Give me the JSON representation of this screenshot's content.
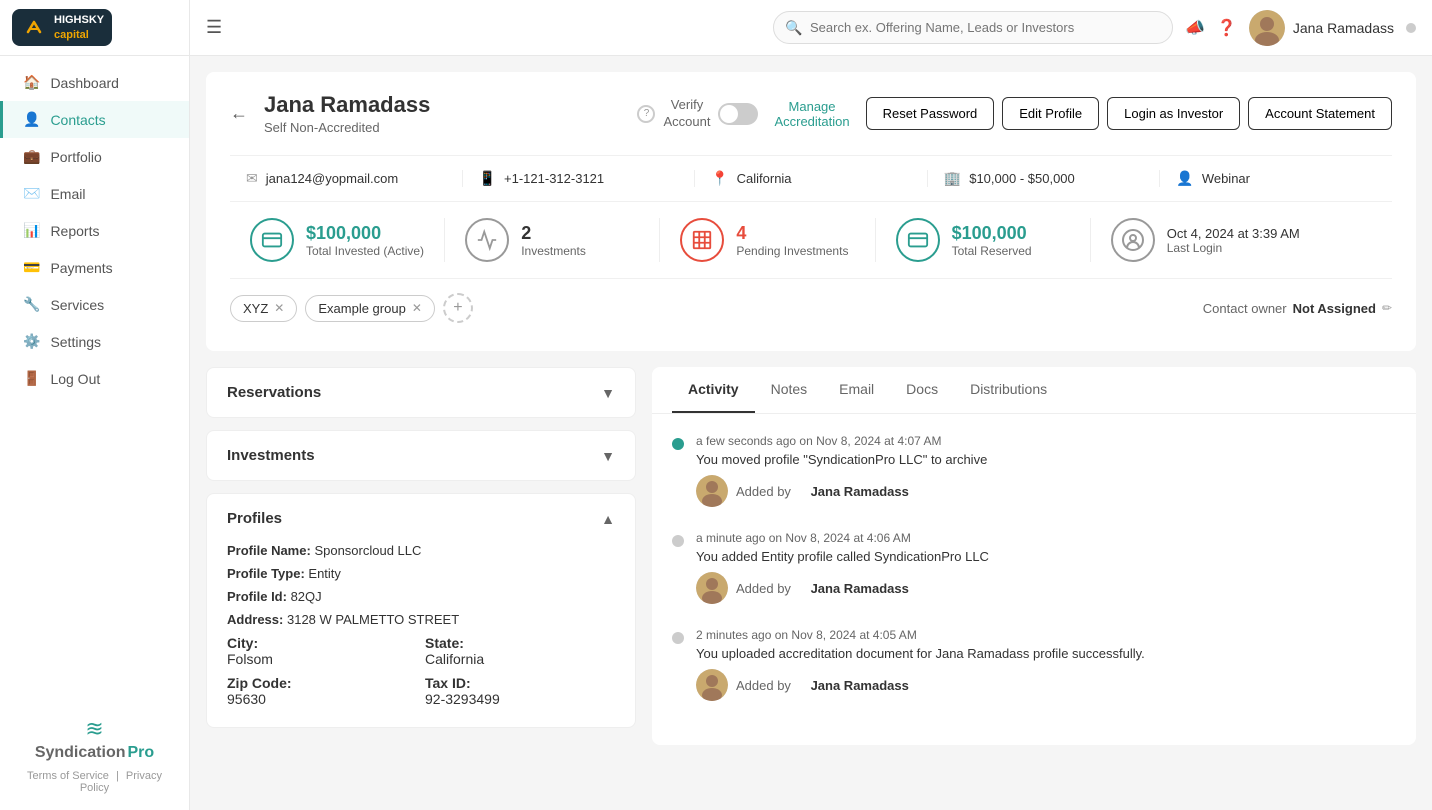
{
  "topnav": {
    "logo_text": "HIGHSKY\ncapital",
    "search_placeholder": "Search ex. Offering Name, Leads or Investors",
    "user_name": "Jana Ramadass"
  },
  "sidebar": {
    "items": [
      {
        "id": "dashboard",
        "label": "Dashboard",
        "icon": "🏠"
      },
      {
        "id": "contacts",
        "label": "Contacts",
        "icon": "👤",
        "active": true
      },
      {
        "id": "portfolio",
        "label": "Portfolio",
        "icon": "💼"
      },
      {
        "id": "email",
        "label": "Email",
        "icon": "✉️"
      },
      {
        "id": "reports",
        "label": "Reports",
        "icon": "📊"
      },
      {
        "id": "payments",
        "label": "Payments",
        "icon": "💳"
      },
      {
        "id": "services",
        "label": "Services",
        "icon": "🔧"
      },
      {
        "id": "settings",
        "label": "Settings",
        "icon": "⚙️"
      },
      {
        "id": "logout",
        "label": "Log Out",
        "icon": "🚪"
      }
    ],
    "brand": {
      "line1": "Syndication",
      "line2": "Pro",
      "links": [
        "Terms of Service",
        "Privacy Policy"
      ]
    }
  },
  "profile": {
    "name": "Jana Ramadass",
    "status": "Self Non-Accredited",
    "verify_label": "Verify\nAccount",
    "manage_accreditation": "Manage\nAccreditation",
    "email": "jana124@yopmail.com",
    "phone": "+1-121-312-3121",
    "location": "California",
    "investment_range": "$10,000 - $50,000",
    "source": "Webinar",
    "stats": [
      {
        "value": "$100,000",
        "label": "Total Invested (Active)",
        "color": "green",
        "icon": "💰"
      },
      {
        "value": "2",
        "label": "Investments",
        "color": "gray",
        "icon": "📈"
      },
      {
        "value": "4",
        "label": "Pending Investments",
        "color": "red",
        "icon": "🏦"
      },
      {
        "value": "$100,000",
        "label": "Total Reserved",
        "color": "green",
        "icon": "💰"
      }
    ],
    "last_login": "Oct 4, 2024 at 3:39 AM",
    "last_login_label": "Last Login",
    "tags": [
      "XYZ",
      "Example group"
    ],
    "contact_owner_label": "Contact owner",
    "contact_owner_value": "Not Assigned",
    "buttons": {
      "reset_password": "Reset Password",
      "edit_profile": "Edit Profile",
      "login_as_investor": "Login as Investor",
      "account_statement": "Account Statement"
    }
  },
  "left_panels": [
    {
      "id": "reservations",
      "title": "Reservations",
      "open": false
    },
    {
      "id": "investments",
      "title": "Investments",
      "open": false
    },
    {
      "id": "profiles",
      "title": "Profiles",
      "open": true,
      "fields": [
        {
          "label": "Profile Name:",
          "value": "Sponsorcloud LLC"
        },
        {
          "label": "Profile Type:",
          "value": "Entity"
        },
        {
          "label": "Profile Id:",
          "value": "82QJ"
        },
        {
          "label": "Address:",
          "value": "3128 W PALMETTO STREET"
        }
      ],
      "grid_fields": [
        {
          "label": "City:",
          "value": "Folsom"
        },
        {
          "label": "State:",
          "value": "California"
        },
        {
          "label": "Zip Code:",
          "value": "95630"
        },
        {
          "label": "Tax ID:",
          "value": "92-3293499"
        }
      ]
    }
  ],
  "right_panel": {
    "tabs": [
      {
        "id": "activity",
        "label": "Activity",
        "active": true
      },
      {
        "id": "notes",
        "label": "Notes",
        "active": false
      },
      {
        "id": "email",
        "label": "Email",
        "active": false
      },
      {
        "id": "docs",
        "label": "Docs",
        "active": false
      },
      {
        "id": "distributions",
        "label": "Distributions",
        "active": false
      }
    ],
    "activity_items": [
      {
        "dot": "green",
        "time": "a few seconds ago on Nov 8, 2024 at 4:07 AM",
        "text": "You moved profile \"SyndicationPro LLC\" to archive",
        "added_by": "Added by",
        "user": "Jana Ramadass"
      },
      {
        "dot": "gray",
        "time": "a minute ago on Nov 8, 2024 at 4:06 AM",
        "text": "You added Entity profile called SyndicationPro LLC",
        "added_by": "Added by",
        "user": "Jana Ramadass"
      },
      {
        "dot": "gray",
        "time": "2 minutes ago on Nov 8, 2024 at 4:05 AM",
        "text": "You uploaded accreditation document for Jana Ramadass profile successfully.",
        "added_by": "Added by",
        "user": "Jana Ramadass"
      }
    ]
  }
}
